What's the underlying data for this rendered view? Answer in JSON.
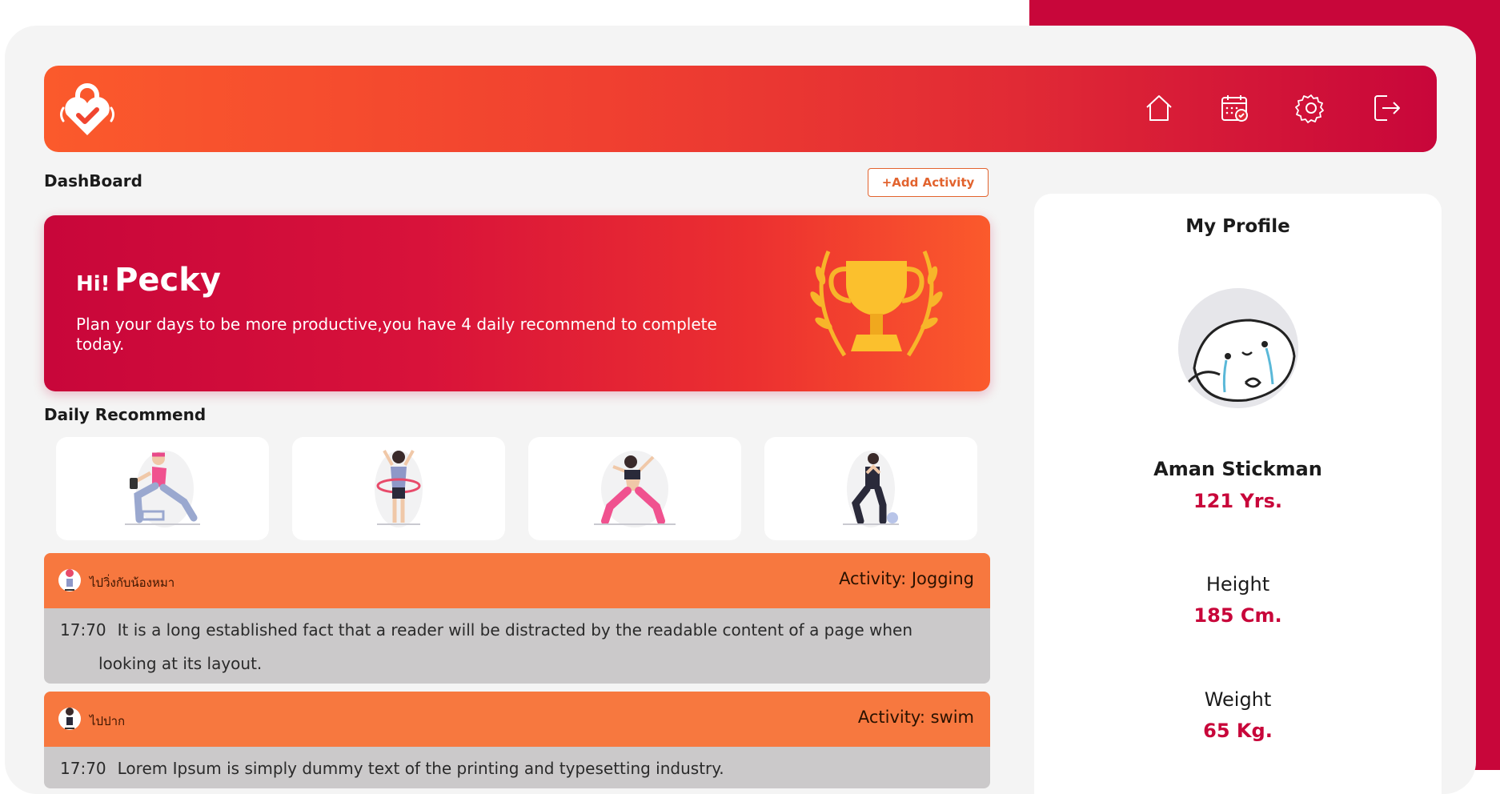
{
  "nav": {
    "icons": [
      "home-icon",
      "calendar-check-icon",
      "gear-icon",
      "logout-icon"
    ]
  },
  "dashboard": {
    "title": "DashBoard",
    "add_activity_label": "+Add Activity"
  },
  "hero": {
    "hi": "Hi!",
    "name": "Pecky",
    "message": "Plan your days to be more productive,you have 4 daily recommend to complete today."
  },
  "daily_recommend": {
    "title": "Daily Recommend",
    "items": [
      {
        "icon": "exercise-dumbbell-illustration"
      },
      {
        "icon": "exercise-hula-hoop-illustration"
      },
      {
        "icon": "exercise-dance-illustration"
      },
      {
        "icon": "exercise-ball-illustration"
      }
    ]
  },
  "activities": [
    {
      "name": "ไปวิ่งกับน้องหมา",
      "type": "Activity: Jogging",
      "time": "17:70",
      "desc_line1": "It is a long established fact that a reader will be distracted by the readable content of a page when",
      "desc_line2": "looking at its layout."
    },
    {
      "name": "ไปปาก",
      "type": "Activity: swim",
      "time": "17:70",
      "desc_line1": "Lorem Ipsum is simply dummy text of the printing and typesetting industry."
    }
  ],
  "profile": {
    "title": "My Profile",
    "name": "Aman Stickman",
    "age": "121 Yrs.",
    "height_label": "Height",
    "height_value": "185 Cm.",
    "weight_label": "Weight",
    "weight_value": "65 Kg."
  },
  "colors": {
    "brand": "#c8063a",
    "accent": "#f7783f",
    "background": "#f4f4f4"
  }
}
